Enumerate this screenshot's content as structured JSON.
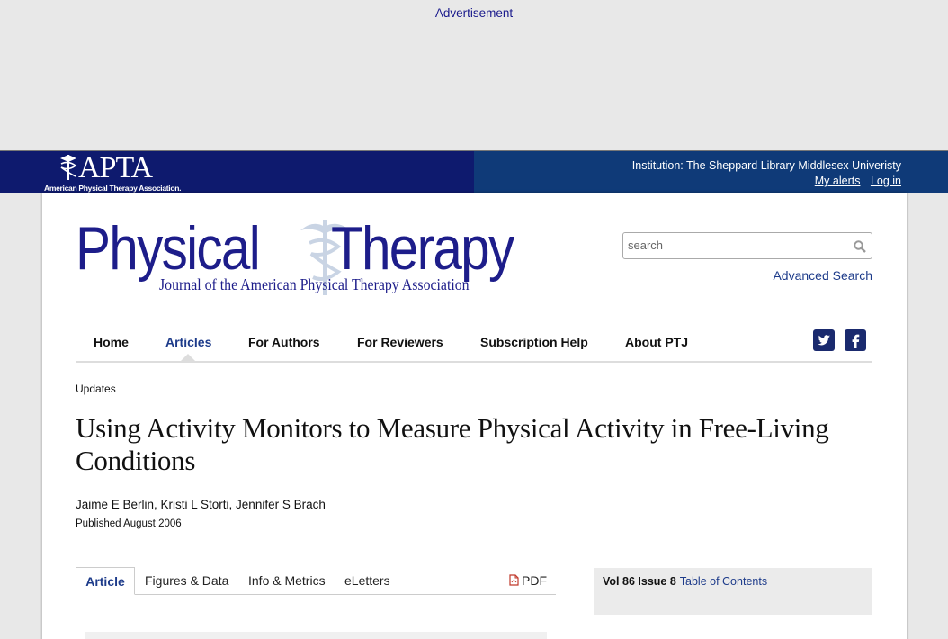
{
  "ad": {
    "label": "Advertisement"
  },
  "topbar": {
    "apta_word": "APTA",
    "apta_sub": "American Physical Therapy Association.",
    "institution": "Institution: The Sheppard Library Middlesex Univeristy",
    "my_alerts": "My alerts",
    "log_in": "Log in"
  },
  "logo": {
    "word1": "Physical",
    "word2": "Therapy",
    "subtitle": "Journal of the American Physical Therapy Association"
  },
  "search": {
    "placeholder": "search",
    "advanced": "Advanced Search"
  },
  "nav": {
    "items": [
      "Home",
      "Articles",
      "For Authors",
      "For Reviewers",
      "Subscription Help",
      "About PTJ"
    ],
    "active": "Articles"
  },
  "social": {
    "twitter": "twitter-icon",
    "facebook": "facebook-icon"
  },
  "article": {
    "section": "Updates",
    "title": "Using Activity Monitors to Measure Physical Activity in Free-Living Conditions",
    "authors": "Jaime E Berlin, Kristi L Storti, Jennifer S Brach",
    "published": "Published August 2006"
  },
  "tabs": {
    "items": [
      "Article",
      "Figures & Data",
      "Info & Metrics",
      "eLetters"
    ],
    "pdf": "PDF"
  },
  "issue": {
    "vol": "Vol 86",
    "issue": "Issue 8",
    "toc": "Table of Contents"
  },
  "colors": {
    "navy": "#0e1a6e",
    "blue": "#0f3a78",
    "brand_text": "#1d1d8a",
    "link": "#1d3b8a"
  }
}
